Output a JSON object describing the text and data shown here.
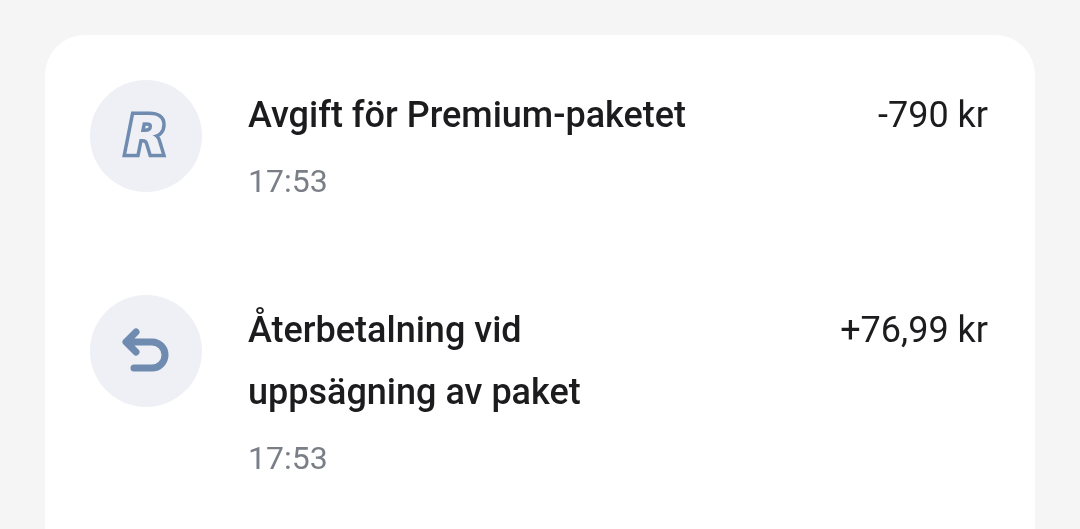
{
  "transactions": [
    {
      "kind": "logo",
      "logo_text": "R",
      "title": "Avgift för Premium-paketet",
      "time": "17:53",
      "amount": "-790 kr"
    },
    {
      "kind": "refund",
      "title": "Återbetalning vid uppsägning av paket",
      "time": "17:53",
      "amount": "+76,99 kr"
    }
  ]
}
